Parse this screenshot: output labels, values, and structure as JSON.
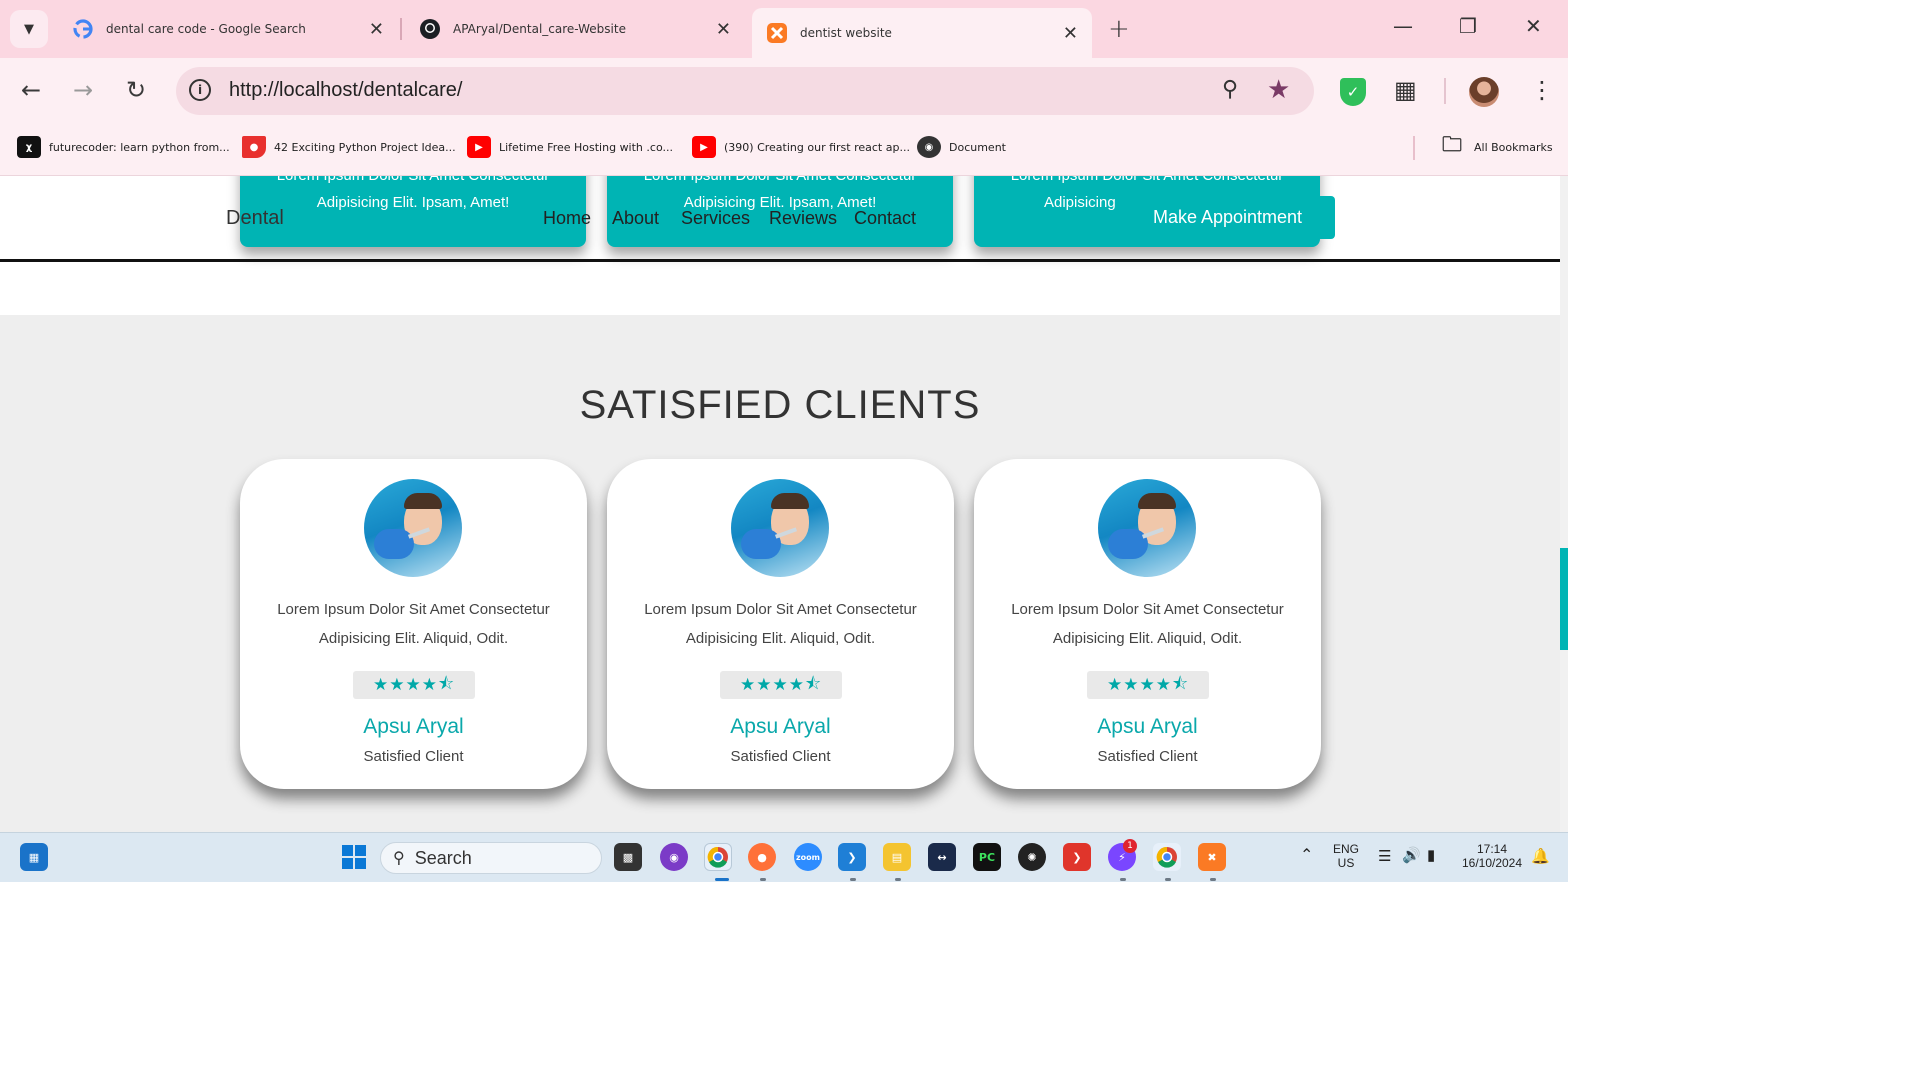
{
  "browser": {
    "tabs": [
      {
        "title": "dental care code - Google Search",
        "icon": "google-icon"
      },
      {
        "title": "APAryal/Dental_care-Website",
        "icon": "github-icon"
      },
      {
        "title": "dentist website",
        "icon": "xampp-icon",
        "active": true
      }
    ],
    "url": "http://localhost/dentalcare/",
    "bookmarks": [
      {
        "label": "futurecoder: learn python from...",
        "icon": "futurecoder-icon"
      },
      {
        "label": "42 Exciting Python Project Idea...",
        "icon": "bookmark-red-icon"
      },
      {
        "label": "Lifetime Free Hosting with .co...",
        "icon": "youtube-icon"
      },
      {
        "label": "(390) Creating our first react ap...",
        "icon": "youtube-icon"
      },
      {
        "label": "Document",
        "icon": "globe-icon"
      }
    ],
    "all_bookmarks": "All Bookmarks"
  },
  "site": {
    "brand": "Dental",
    "nav": [
      "Home",
      "About",
      "Services",
      "Reviews",
      "Contact"
    ],
    "cta": "Make Appointment",
    "service_cards": [
      {
        "line1": "Lorem Ipsum Dolor Sit Amet Consectetur",
        "line2": "Adipisicing Elit. Ipsam, Amet!"
      },
      {
        "line1": "Lorem Ipsum Dolor Sit Amet Consectetur",
        "line2": "Adipisicing Elit. Ipsam, Amet!"
      },
      {
        "line1": "Lorem Ipsum Dolor Sit Amet Consectetur",
        "line2": "Adipisicing"
      }
    ],
    "clients_title": "SATISFIED CLIENTS",
    "clients": [
      {
        "review_line1": "Lorem Ipsum Dolor Sit Amet Consectetur",
        "review_line2": "Adipisicing Elit. Aliquid, Odit.",
        "rating": 4.5,
        "rating_max": 5,
        "name": "Apsu Aryal",
        "role": "Satisfied Client"
      },
      {
        "review_line1": "Lorem Ipsum Dolor Sit Amet Consectetur",
        "review_line2": "Adipisicing Elit. Aliquid, Odit.",
        "rating": 4.5,
        "rating_max": 5,
        "name": "Apsu Aryal",
        "role": "Satisfied Client"
      },
      {
        "review_line1": "Lorem Ipsum Dolor Sit Amet Consectetur",
        "review_line2": "Adipisicing Elit. Aliquid, Odit.",
        "rating": 4.5,
        "rating_max": 5,
        "name": "Apsu Aryal",
        "role": "Satisfied Client"
      }
    ],
    "accent": "#00b4b4"
  },
  "taskbar": {
    "search_placeholder": "Search",
    "messenger_badge": "1",
    "lang": "ENG",
    "region": "US",
    "time": "17:14",
    "date": "16/10/2024"
  }
}
